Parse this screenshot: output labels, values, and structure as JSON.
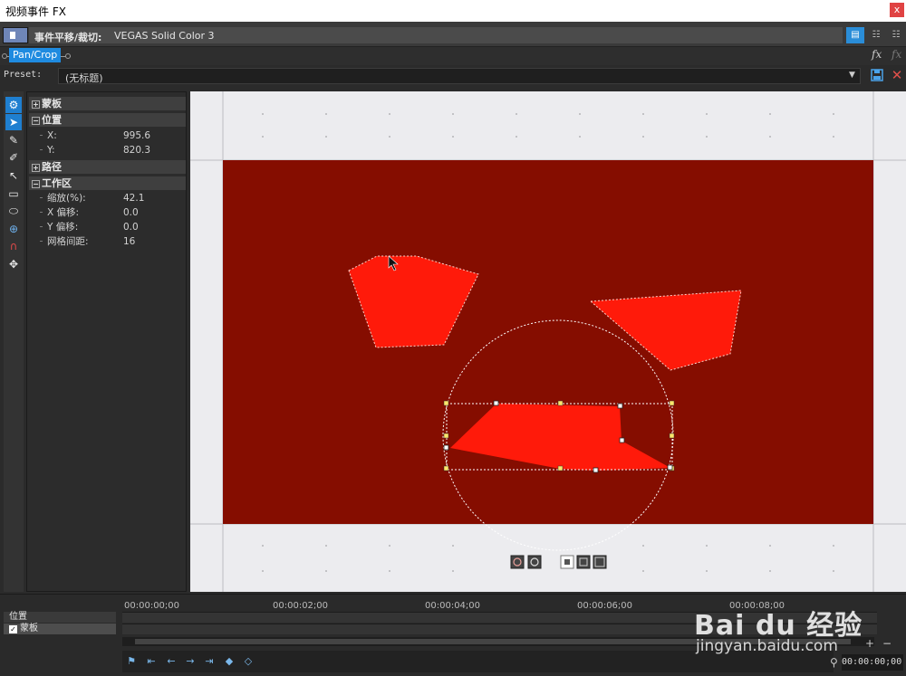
{
  "window": {
    "title": "视频事件 FX",
    "close": "x"
  },
  "header": {
    "event_label": "事件平移/裁切:",
    "event_name": "VEGAS Solid Color 3"
  },
  "fx_chain": {
    "plugin": "Pan/Crop"
  },
  "preset": {
    "label": "Preset:",
    "value": "(无标题)"
  },
  "props": {
    "sections": {
      "mask": "蒙板",
      "position": "位置",
      "path": "路径",
      "workspace": "工作区"
    },
    "position": [
      {
        "key": "X:",
        "value": "995.6"
      },
      {
        "key": "Y:",
        "value": "820.3"
      }
    ],
    "workspace": [
      {
        "key": "缩放(%):",
        "value": "42.1"
      },
      {
        "key": "X 偏移:",
        "value": "0.0"
      },
      {
        "key": "Y 偏移:",
        "value": "0.0"
      },
      {
        "key": "网格间距:",
        "value": "16"
      }
    ]
  },
  "colors": {
    "frame": "#850d00",
    "mask_fill": "#ff1a0a",
    "accent": "#1f8be0",
    "canvas_bg": "#ececef"
  },
  "tools": [
    "gear-icon",
    "pointer-icon",
    "pen-icon",
    "pen-add-icon",
    "corner-icon",
    "rectangle-icon",
    "ellipse-icon",
    "zoom-icon",
    "magnet-icon",
    "move-icon"
  ],
  "timeline": {
    "tracks": [
      {
        "label": "位置"
      },
      {
        "label": "蒙板",
        "checked": true
      }
    ],
    "ticks": [
      "00:00:00;00",
      "00:00:02;00",
      "00:00:04;00",
      "00:00:06;00",
      "00:00:08;00"
    ],
    "timecode": "00:00:00;00"
  },
  "watermark": {
    "brand": "Bai du 经验",
    "url": "jingyan.baidu.com"
  }
}
